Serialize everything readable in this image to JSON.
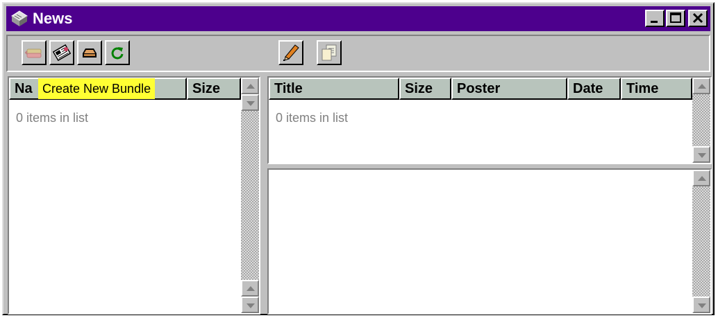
{
  "window": {
    "title": "News",
    "title_icon": "news-app-icon",
    "controls": [
      "minimize-icon",
      "maximize-icon",
      "close-icon"
    ],
    "title_bar_color": "#4d008d"
  },
  "toolbar": {
    "left_buttons": [
      "bundle-icon",
      "newspaper-icon",
      "inbox-tray-icon",
      "refresh-icon"
    ],
    "right_buttons": [
      "pencil-icon",
      "copy-pages-icon"
    ]
  },
  "tooltip": {
    "text": "Create New Bundle",
    "color": "#ffff33"
  },
  "left_list": {
    "columns": {
      "name": "Na",
      "size": "Size"
    },
    "empty_text": "0 items in list"
  },
  "message_list": {
    "columns": {
      "title": "Title",
      "size": "Size",
      "poster": "Poster",
      "date": "Date",
      "time": "Time"
    },
    "empty_text": "0 items in list"
  },
  "colors": {
    "header_bg": "#b8c4bc",
    "face": "#c0c0c0"
  }
}
